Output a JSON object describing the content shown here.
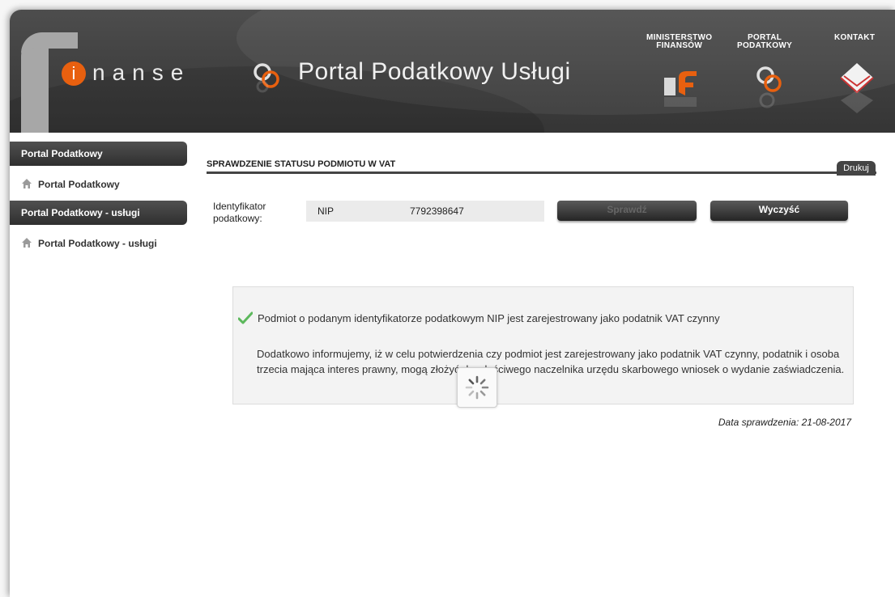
{
  "header": {
    "logo_i": "i",
    "logo_rest": "nanse",
    "portal_title": "Portal Podatkowy Usługi",
    "links": [
      {
        "line1": "MINISTERSTWO",
        "line2": "FINANSÓW",
        "icon": "ministry-logo-icon"
      },
      {
        "line1": "PORTAL",
        "line2": "PODATKOWY",
        "icon": "portal-knot-icon"
      },
      {
        "line1": "KONTAKT",
        "line2": "",
        "icon": "envelope-icon"
      }
    ]
  },
  "sidebar": {
    "sections": [
      {
        "heading": "Portal Podatkowy",
        "item": "Portal Podatkowy"
      },
      {
        "heading": "Portal Podatkowy - usługi",
        "item": "Portal Podatkowy - usługi"
      }
    ]
  },
  "main": {
    "section_title": "SPRAWDZENIE STATUSU PODMIOTU W VAT",
    "print_label": "Drukuj",
    "identifier_label": "Identyfikator podatkowy:",
    "id_type": "NIP",
    "id_value": "7792398647",
    "check_button": "Sprawdź",
    "clear_button": "Wyczyść",
    "result_message": "Podmiot o podanym identyfikatorze podatkowym NIP jest zarejestrowany jako podatnik VAT czynny",
    "result_note": "Dodatkowo informujemy, iż w celu potwierdzenia czy podmiot jest zarejestrowany jako podatnik VAT czynny, podatnik i osoba trzecia mająca interes prawny, mogą złożyć do właściwego naczelnika urzędu skarbowego wniosek o wydanie zaświadczenia.",
    "check_date": "Data sprawdzenia: 21-08-2017"
  },
  "colors": {
    "accent_orange": "#e8600f",
    "header_dark": "#404040",
    "check_green": "#5cb85c"
  }
}
